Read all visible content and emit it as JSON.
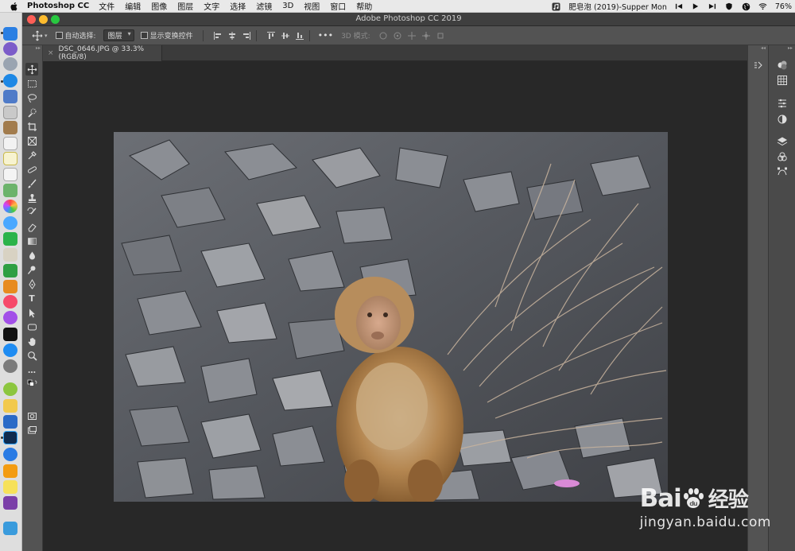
{
  "menubar": {
    "app_name": "Photoshop CC",
    "items": [
      "文件",
      "编辑",
      "图像",
      "图层",
      "文字",
      "选择",
      "滤镜",
      "3D",
      "视图",
      "窗口",
      "帮助"
    ],
    "now_playing": "肥皂泡 (2019)-Supper Mon",
    "battery": "76%"
  },
  "window": {
    "title": "Adobe Photoshop CC 2019"
  },
  "options": {
    "auto_select_label": "自动选择:",
    "auto_select_value": "图层",
    "show_transform_label": "显示变换控件",
    "mode_3d_label": "3D 模式:"
  },
  "document": {
    "tab_label": "DSC_0646.JPG @ 33.3%(RGB/8)",
    "close_glyph": "×"
  },
  "tools": {
    "text_tool_glyph": "T",
    "more_glyph": "…"
  },
  "colors": {
    "foreground": "#f2d27a",
    "background": "#ffffff"
  },
  "watermark": {
    "brand_latin": "Bai",
    "brand_mark": "du",
    "brand_cn": "经验",
    "url": "jingyan.baidu.com"
  }
}
